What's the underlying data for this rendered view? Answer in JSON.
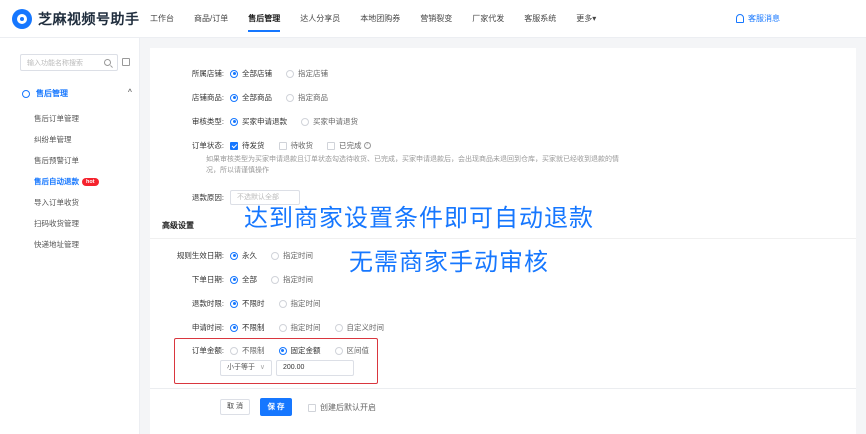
{
  "app": {
    "title": "芝麻视频号助手"
  },
  "nav": {
    "items": [
      "工作台",
      "商品/订单",
      "售后管理",
      "达人分享员",
      "本地团购券",
      "营销裂变",
      "厂家代发",
      "客服系统",
      "更多▾"
    ],
    "active_index": 2,
    "notice": "客服消息"
  },
  "sidebar": {
    "search_placeholder": "输入功能名称搜索",
    "group_label": "售后管理",
    "items": [
      {
        "label": "售后订单管理",
        "active": false
      },
      {
        "label": "纠纷单管理",
        "active": false
      },
      {
        "label": "售后预警订单",
        "active": false
      },
      {
        "label": "售后自动退款",
        "active": true,
        "badge": "hot"
      },
      {
        "label": "导入订单收货",
        "active": false
      },
      {
        "label": "扫码收货管理",
        "active": false
      },
      {
        "label": "快递地址管理",
        "active": false
      }
    ]
  },
  "form": {
    "shop": {
      "label": "所属店铺:",
      "options": [
        "全部店铺",
        "指定店铺"
      ],
      "selected": 0
    },
    "product": {
      "label": "店铺商品:",
      "options": [
        "全部商品",
        "指定商品"
      ],
      "selected": 0
    },
    "review_type": {
      "label": "审核类型:",
      "options": [
        "买家申请退款",
        "买家申请退货"
      ],
      "selected": 0
    },
    "order_status": {
      "label": "订单状态:",
      "options": [
        "待发货",
        "待收货",
        "已完成"
      ],
      "checked": [
        0
      ]
    },
    "order_status_note": "如果审核类型为买家申请退款且订单状态勾选待收货、已完成，买家申请退款后，会出现商品未退回到仓库，买家就已经收到退款的情况，所以请谨慎操作",
    "refund_reason": {
      "label": "退款原因:",
      "placeholder": "不选默认全部"
    },
    "advanced_title": "高级设置",
    "effective_date": {
      "label": "规则生效日期:",
      "options": [
        "永久",
        "指定时间"
      ],
      "selected": 0
    },
    "order_date": {
      "label": "下单日期:",
      "options": [
        "全部",
        "指定时间"
      ],
      "selected": 0
    },
    "refund_time": {
      "label": "退款时限:",
      "options": [
        "不限时",
        "指定时间"
      ],
      "selected": 0
    },
    "apply_time": {
      "label": "申请时间:",
      "options": [
        "不限制",
        "指定时间",
        "自定义时间"
      ],
      "selected": 0
    },
    "order_amount": {
      "label": "订单金额:",
      "options": [
        "不限制",
        "固定金额",
        "区间值"
      ],
      "selected": 1,
      "comparator": "小于等于",
      "value": "200.00"
    }
  },
  "footer": {
    "cancel": "取 消",
    "save": "保 存",
    "default_on": "创建后默认开启"
  },
  "overlay": {
    "line1": "达到商家设置条件即可自动退款",
    "line2": "无需商家手动审核"
  }
}
